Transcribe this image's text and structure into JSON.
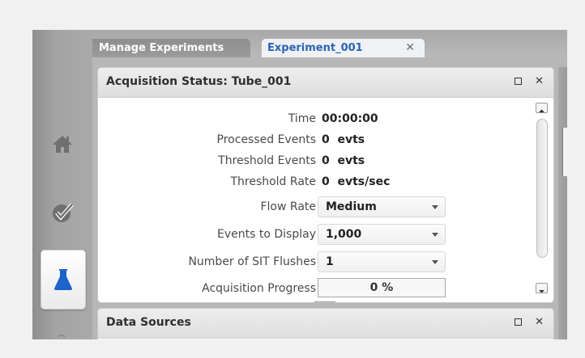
{
  "tabs": [
    {
      "label": "Manage Experiments"
    },
    {
      "label": "Experiment_001",
      "close": "✕"
    }
  ],
  "sidebar": {
    "items": [
      {
        "name": "home"
      },
      {
        "name": "check"
      },
      {
        "name": "experiment",
        "active": true
      }
    ]
  },
  "acquisition_panel": {
    "title": "Acquisition Status: Tube_001",
    "close": "✕",
    "fields": {
      "time": {
        "label": "Time",
        "value": "00:00:00"
      },
      "processed": {
        "label": "Processed Events",
        "value": "0  evts"
      },
      "threshold_events": {
        "label": "Threshold Events",
        "value": "0  evts"
      },
      "threshold_rate": {
        "label": "Threshold Rate",
        "value": "0  evts/sec"
      },
      "flow_rate": {
        "label": "Flow Rate",
        "value": "Medium"
      },
      "events_display": {
        "label": "Events to Display",
        "value": "1,000"
      },
      "sit_flushes": {
        "label": "Number of SIT Flushes",
        "value": "1"
      },
      "progress": {
        "label": "Acquisition Progress",
        "value": "0 %",
        "fraction": 0
      }
    }
  },
  "data_sources_panel": {
    "title": "Data Sources",
    "close": "✕"
  },
  "colors": {
    "accent_blue": "#2b64b5",
    "icon_gray": "#6f6f6f"
  }
}
